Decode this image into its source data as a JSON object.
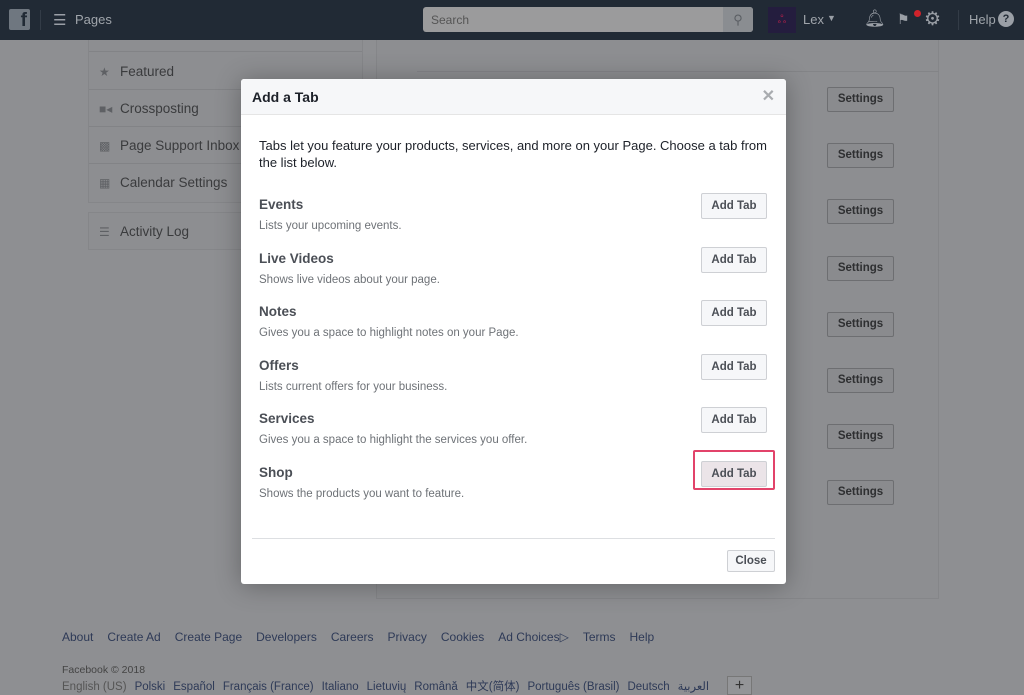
{
  "topbar": {
    "logo": "f",
    "menu_label": "Pages",
    "search_placeholder": "Search",
    "user": "Lex",
    "help": "Help",
    "icons": [
      "menu-icon",
      "search-icon",
      "avatar",
      "chevron-down-icon",
      "bell-icon",
      "flag-icon",
      "gear-icon",
      "help-icon"
    ],
    "notification_color": "#d0232b"
  },
  "sidebar": {
    "items": [
      {
        "label": "Featured",
        "icon": "star-icon"
      },
      {
        "label": "Crossposting",
        "icon": "video-icon"
      },
      {
        "label": "Page Support Inbox",
        "icon": "facebook-icon"
      },
      {
        "label": "Calendar Settings",
        "icon": "calendar-icon"
      }
    ],
    "activity_log": "Activity Log"
  },
  "content": {
    "settings_label": "Settings"
  },
  "modal": {
    "title": "Add a Tab",
    "description": "Tabs let you feature your products, services, and more on your Page. Choose a tab from the list below.",
    "tabs": [
      {
        "title": "Events",
        "desc": "Lists your upcoming events.",
        "button": "Add Tab"
      },
      {
        "title": "Live Videos",
        "desc": "Shows live videos about your page.",
        "button": "Add Tab"
      },
      {
        "title": "Notes",
        "desc": "Gives you a space to highlight notes on your Page.",
        "button": "Add Tab"
      },
      {
        "title": "Offers",
        "desc": "Lists current offers for your business.",
        "button": "Add Tab"
      },
      {
        "title": "Services",
        "desc": "Gives you a space to highlight the services you offer.",
        "button": "Add Tab"
      },
      {
        "title": "Shop",
        "desc": "Shows the products you want to feature.",
        "button": "Add Tab",
        "highlighted": true
      }
    ],
    "close": "Close",
    "highlight_color": "#e2436a"
  },
  "footer": {
    "links": [
      "About",
      "Create Ad",
      "Create Page",
      "Developers",
      "Careers",
      "Privacy",
      "Cookies",
      "Ad Choices",
      "Terms",
      "Help"
    ],
    "copyright": "Facebook © 2018",
    "current_language": "English (US)",
    "languages": [
      "Polski",
      "Español",
      "Français (France)",
      "Italiano",
      "Lietuvių",
      "Română",
      "中文(简体)",
      "Português (Brasil)",
      "Deutsch",
      "العربية"
    ],
    "more": "+"
  }
}
